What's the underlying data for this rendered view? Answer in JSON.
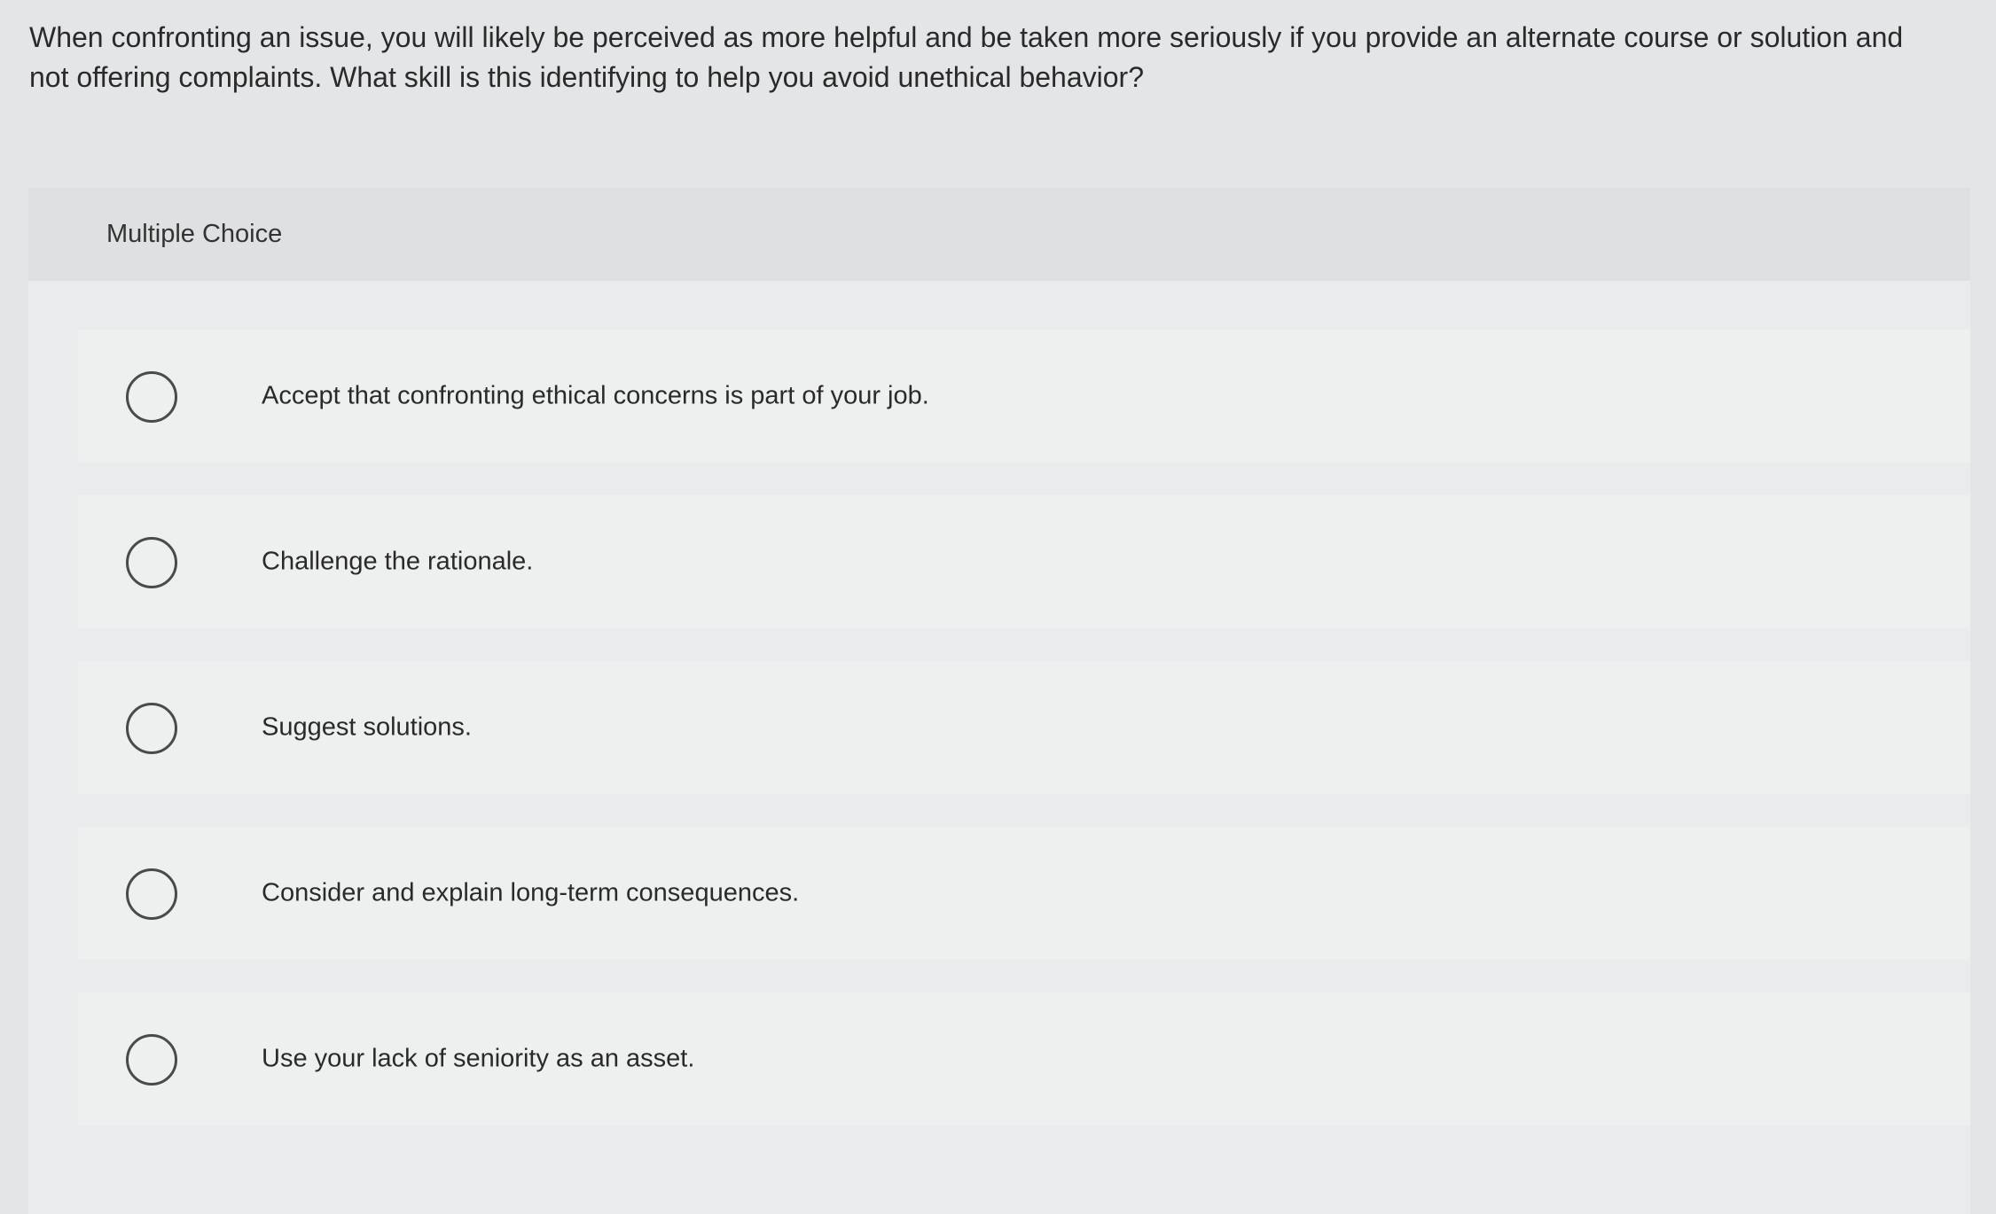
{
  "question": {
    "text": "When confronting an issue, you will likely be perceived as more helpful and be taken more seriously if you provide an alternate course or solution and not offering complaints. What skill is this identifying to help you avoid unethical behavior?"
  },
  "panel": {
    "header_label": "Multiple Choice"
  },
  "choices": [
    {
      "label": "Accept that confronting ethical concerns is part of your job.",
      "selected": false
    },
    {
      "label": "Challenge the rationale.",
      "selected": false
    },
    {
      "label": "Suggest solutions.",
      "selected": false
    },
    {
      "label": "Consider and explain long-term consequences.",
      "selected": false
    },
    {
      "label": "Use your lack of seniority as an asset.",
      "selected": false
    }
  ]
}
